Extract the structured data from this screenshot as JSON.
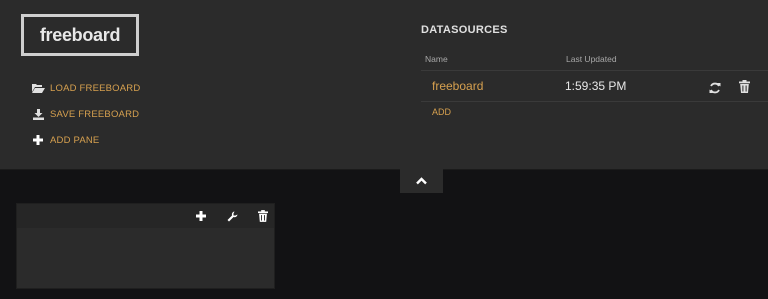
{
  "app": {
    "logo_text": "freeboard"
  },
  "menu": {
    "items": [
      {
        "label": "LOAD FREEBOARD",
        "icon": "folder-open-icon"
      },
      {
        "label": "SAVE FREEBOARD",
        "icon": "download-icon"
      },
      {
        "label": "ADD PANE",
        "icon": "plus-icon"
      }
    ]
  },
  "datasources": {
    "title": "DATASOURCES",
    "columns": {
      "name": "Name",
      "last_updated": "Last Updated"
    },
    "rows": [
      {
        "name": "freeboard",
        "last_updated": "1:59:35 PM"
      }
    ],
    "add_label": "ADD"
  },
  "pane": {
    "tools": [
      "plus-icon",
      "wrench-icon",
      "trash-icon"
    ]
  },
  "colors": {
    "accent": "#d6a04f",
    "panel": "#2b2b2b",
    "background": "#121214"
  }
}
